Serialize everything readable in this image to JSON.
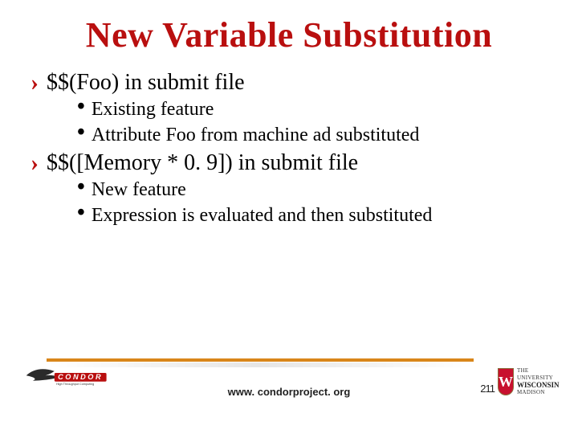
{
  "title": "New Variable Substitution",
  "bullets": {
    "b1": "$$(Foo) in submit file",
    "b1_s1": "Existing feature",
    "b1_s2": "Attribute Foo from machine ad substituted",
    "b2": "$$([Memory * 0. 9]) in submit file",
    "b2_s1": "New feature",
    "b2_s2": "Expression is evaluated and then substituted"
  },
  "footer": {
    "url": "www. condorproject. org",
    "page": "211",
    "condor_tagline": "High Throughput Computing"
  },
  "crest": {
    "letter": "W",
    "line1": "THE UNIVERSITY",
    "line2": "WISCONSIN",
    "line3": "MADISON"
  }
}
